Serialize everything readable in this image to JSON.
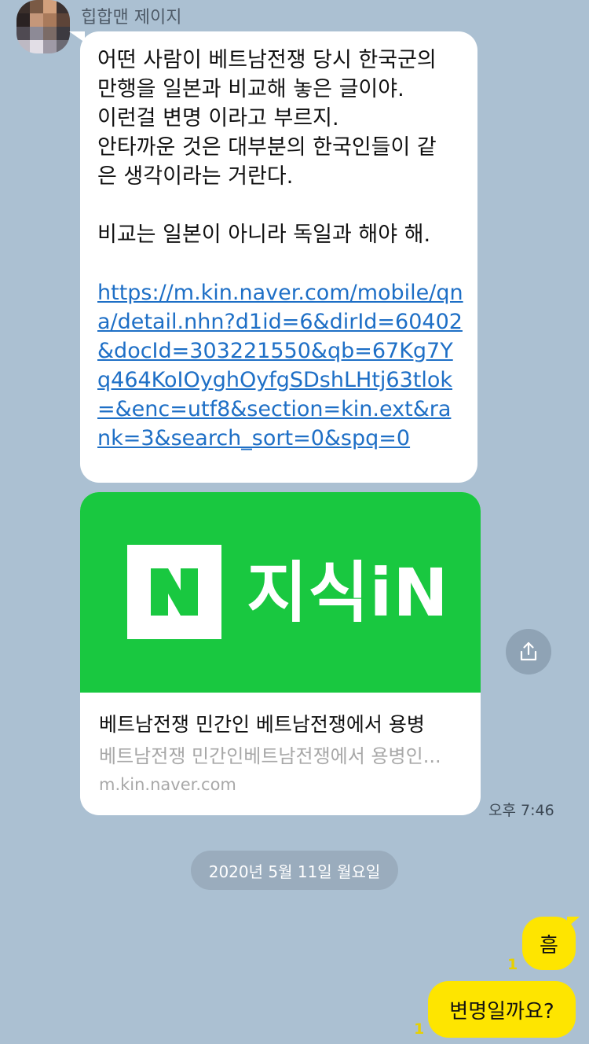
{
  "chat": {
    "incoming": {
      "sender_name": "힙합맨 제이지",
      "message_text": "어떤 사람이 베트남전쟁 당시 한국군의\n만행을 일본과 비교해 놓은 글이야.\n이런걸 변명 이라고 부르지.\n안타까운 것은 대부분의 한국인들이 같\n은 생각이라는 거란다.\n\n비교는 일본이 아니라 독일과 해야 해.",
      "link_url": "https://m.kin.naver.com/mobile/qna/detail.nhn?d1id=6&dirId=60402&docId=303221550&qb=67Kg7Yq464KoIOyghOyfgSDshLHtj63tlok=&enc=utf8&section=kin.ext&rank=3&search_sort=0&spq=0",
      "link_preview": {
        "brand_letter": "N",
        "brand_name": "지식iN",
        "title": "베트남전쟁 민간인 베트남전쟁에서 용병",
        "description": "베트남전쟁 민간인베트남전쟁에서 용병인...",
        "domain": "m.kin.naver.com"
      },
      "time": "오후 7:46"
    },
    "date_divider": "2020년 5월 11일 월요일",
    "outgoing": [
      {
        "text": "흠",
        "unread": "1"
      },
      {
        "text": "변명일까요?",
        "unread": "1"
      }
    ]
  },
  "icons": {
    "share": "share-icon",
    "avatar": "pixelated-avatar"
  },
  "colors": {
    "background": "#abc0d2",
    "outgoing_bubble": "#fee500",
    "incoming_bubble": "#ffffff",
    "brand_green": "#19c840",
    "link": "#1e6fc6"
  }
}
